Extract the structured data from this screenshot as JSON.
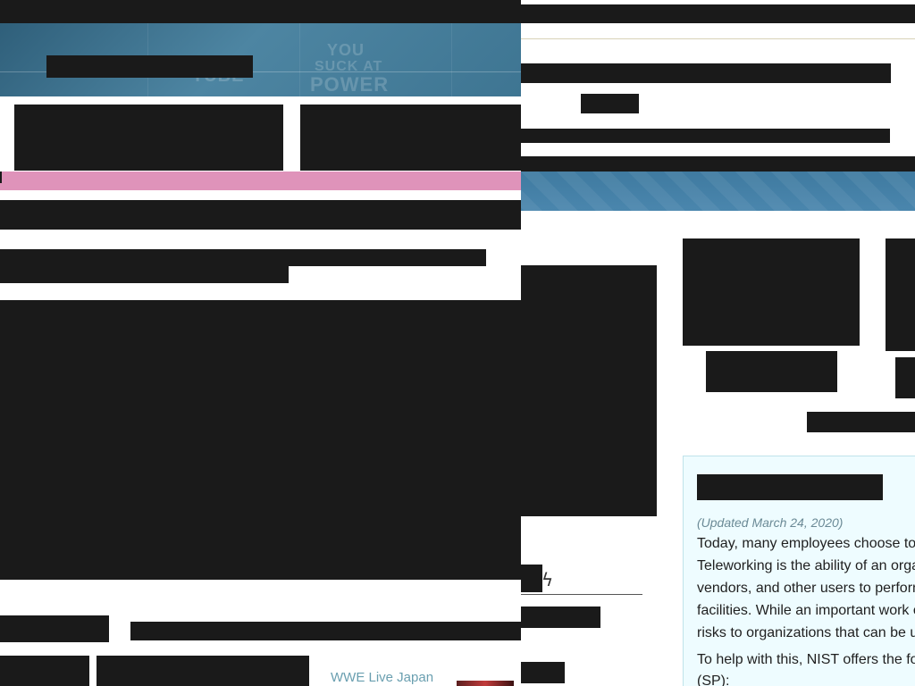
{
  "article": {
    "updated": "(Updated March 24, 2020)",
    "lines": [
      "Today, many employees choose to t",
      "Teleworking is the ability of an orga",
      "vendors, and other users to perform",
      "facilities. While an important work o",
      "risks to organizations that can be u",
      "To help with this, NIST offers the fol",
      "(SP):"
    ]
  },
  "sidebar_link": {
    "label": "WWE Live Japan"
  },
  "hero": {
    "ghost_1": "YOU",
    "ghost_2": "SUCK AT",
    "ghost_3": "POWER",
    "ghost_4": "TUBE"
  },
  "icons": {
    "bolt": "lightning-icon"
  },
  "colors": {
    "redaction": "#1a1a1a",
    "pink_bar": "#df93ba",
    "article_bg": "#eefcff",
    "link": "#6a9fb0"
  }
}
